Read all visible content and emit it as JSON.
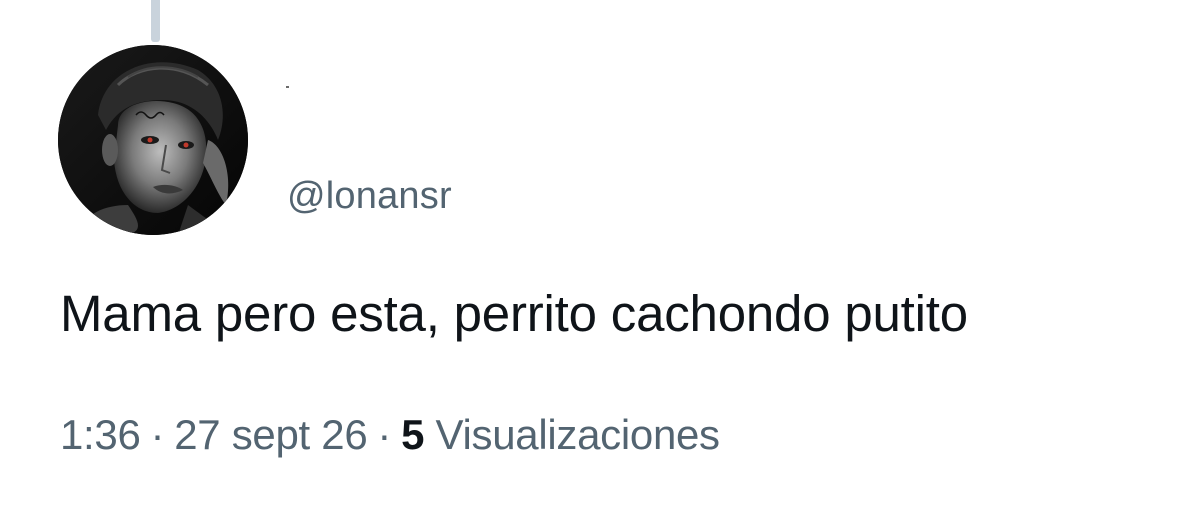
{
  "tweet": {
    "user": {
      "handle": "@lonansr",
      "avatar": "portrait-avatar-icon"
    },
    "text": "Mama pero esta, perrito cachondo putito",
    "meta": {
      "time": "1:36",
      "separator": "·",
      "date": "27 sept 26",
      "views_count": "5",
      "views_label": "Visualizaciones"
    }
  },
  "colors": {
    "text_primary": "#0f1419",
    "text_secondary": "#536471",
    "thread_line": "#c9d3dc",
    "background": "#ffffff"
  }
}
